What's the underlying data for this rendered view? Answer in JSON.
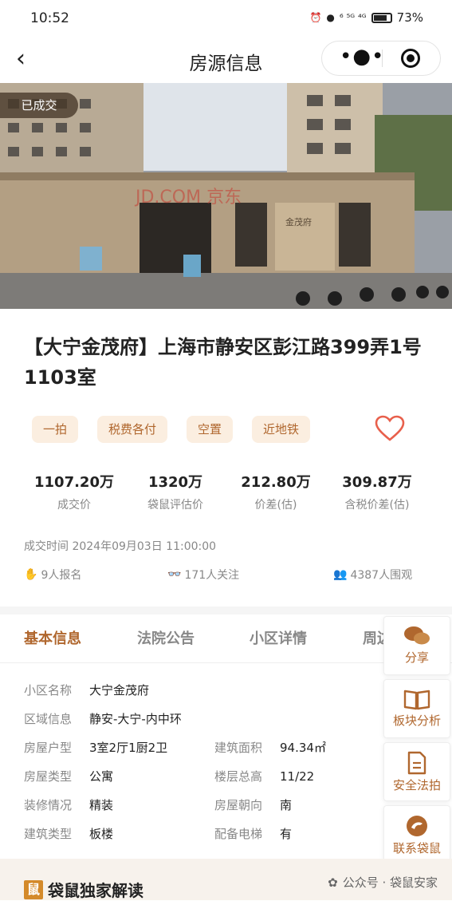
{
  "status_bar": {
    "time": "10:52",
    "battery": "73%",
    "network": "⁶ ⁵ᴳ ⁴ᴳ"
  },
  "nav": {
    "title": "房源信息",
    "back_glyph": "‹",
    "more_glyph": "•●•"
  },
  "photo": {
    "sold_tag": "已成交",
    "watermark": "JD.COM 京东",
    "gate_sign": "金茂府"
  },
  "title": "【大宁金茂府】上海市静安区彭江路399弄1号1103室",
  "tags": [
    "一拍",
    "税费各付",
    "空置",
    "近地铁"
  ],
  "stats": [
    {
      "value": "1107.20万",
      "label": "成交价"
    },
    {
      "value": "1320万",
      "label": "袋鼠评估价"
    },
    {
      "value": "212.80万",
      "label": "价差(估)"
    },
    {
      "value": "309.87万",
      "label": "含税价差(估)"
    }
  ],
  "deal_time": "成交时间 2024年09月03日 11:00:00",
  "counts": {
    "signup": "9人报名",
    "follow": "171人关注",
    "watch": "4387人围观"
  },
  "tabs": [
    "基本信息",
    "法院公告",
    "小区详情",
    "周边"
  ],
  "info": {
    "community": {
      "key": "小区名称",
      "value": "大宁金茂府"
    },
    "region": {
      "key": "区域信息",
      "value": "静安-大宁-内中环"
    },
    "layout": {
      "key": "房屋户型",
      "value": "3室2厅1厨2卫"
    },
    "area": {
      "key": "建筑面积",
      "value": "94.34㎡"
    },
    "house_type": {
      "key": "房屋类型",
      "value": "公寓"
    },
    "floor": {
      "key": "楼层总高",
      "value": "11/22"
    },
    "decoration": {
      "key": "装修情况",
      "value": "精装"
    },
    "orientation": {
      "key": "房屋朝向",
      "value": "南"
    },
    "building_type": {
      "key": "建筑类型",
      "value": "板楼"
    },
    "elevator": {
      "key": "配备电梯",
      "value": "有"
    }
  },
  "side_buttons": [
    "分享",
    "板块分析",
    "安全法拍",
    "联系袋鼠"
  ],
  "exclusive": {
    "title": "袋鼠独家解读",
    "badge": "鼠"
  },
  "watermark": "公众号 · 袋鼠安家",
  "colors": {
    "accent": "#b0672e",
    "tag_bg": "#fbeee0",
    "heart": "#e8604c"
  }
}
